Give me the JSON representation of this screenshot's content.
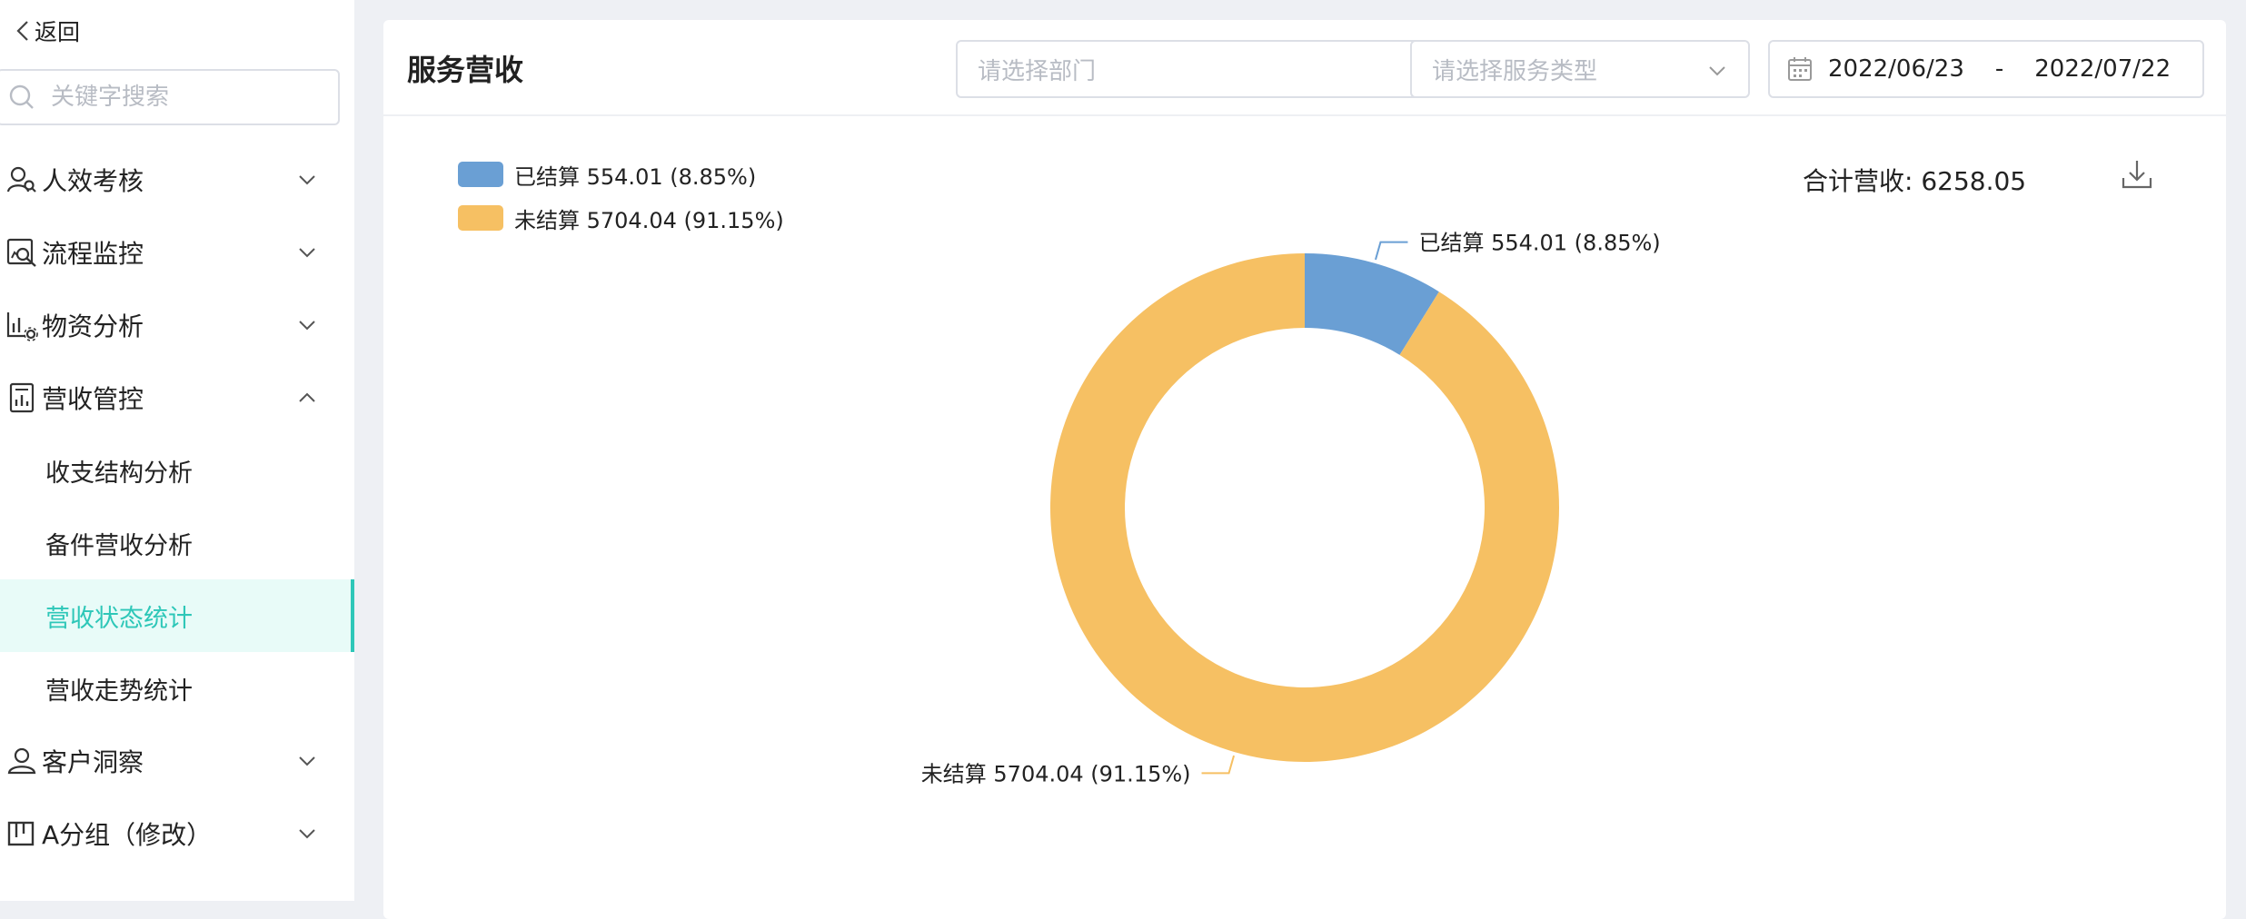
{
  "sidebar": {
    "back_label": "返回",
    "search_placeholder": "关键字搜索",
    "items": [
      {
        "label": "人效考核",
        "icon": "user-search-icon"
      },
      {
        "label": "流程监控",
        "icon": "process-monitor-icon"
      },
      {
        "label": "物资分析",
        "icon": "material-analysis-icon"
      },
      {
        "label": "营收管控",
        "icon": "revenue-control-icon"
      },
      {
        "label": "客户洞察",
        "icon": "customer-insight-icon"
      },
      {
        "label": "A分组（修改）",
        "icon": "group-icon"
      }
    ],
    "sub_items": [
      {
        "label": "收支结构分析"
      },
      {
        "label": "备件营收分析"
      },
      {
        "label": "营收状态统计"
      },
      {
        "label": "营收走势统计"
      }
    ]
  },
  "header": {
    "title": "服务营收",
    "department_placeholder": "请选择部门",
    "service_type_placeholder": "请选择服务类型",
    "date_start": "2022/06/23",
    "date_sep": "-",
    "date_end": "2022/07/22"
  },
  "summary": {
    "total_label": "合计营收: 6258.05"
  },
  "legend": [
    {
      "text": "已结算 554.01 (8.85%)"
    },
    {
      "text": "未结算 5704.04 (91.15%)"
    }
  ],
  "colors": {
    "accent": "#2ec7b8",
    "settled": "#6a9fd4",
    "unsettled": "#f6c063",
    "border": "#dcdfe6"
  },
  "chart_data": {
    "type": "pie",
    "donut": true,
    "categories": [
      "已结算",
      "未结算"
    ],
    "values": [
      554.01,
      5704.04
    ],
    "percentages": [
      8.85,
      91.15
    ],
    "labels": [
      "已结算 554.01 (8.85%)",
      "未结算 5704.04 (91.15%)"
    ],
    "colors": [
      "#6a9fd4",
      "#f6c063"
    ],
    "legend_position": "top-left"
  }
}
